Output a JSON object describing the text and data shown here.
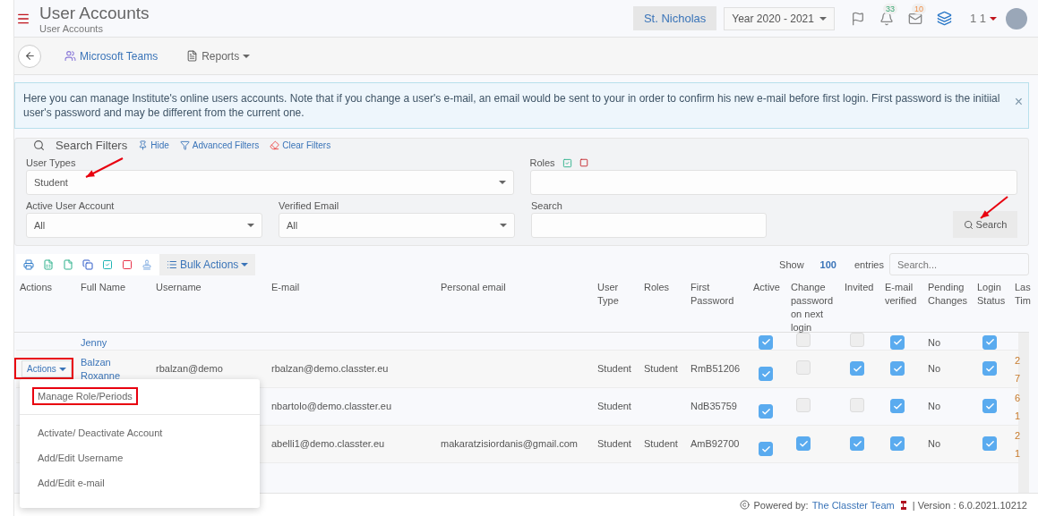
{
  "header": {
    "title": "User Accounts",
    "subtitle": "User Accounts",
    "school": "St. Nicholas",
    "year": "Year 2020 - 2021",
    "notifications": "33",
    "messages": "10",
    "user": "1 1"
  },
  "toolbar": {
    "links": [
      {
        "kind": "teams",
        "label": "Microsoft Teams"
      },
      {
        "kind": "reports",
        "label": "Reports"
      }
    ]
  },
  "alert": {
    "text": "Here you can manage Institute's online users accounts. Note that if you change a user's e-mail, an email would be sent to your in order to confirm his new e-mail before first login. First password is the initiial user's password and may be different from the current one.",
    "close": "×"
  },
  "filters": {
    "legend": "Search Filters",
    "links": [
      {
        "kind": "hide",
        "label": "Hide"
      },
      {
        "kind": "advanced",
        "label": "Advanced Filters"
      },
      {
        "kind": "clear",
        "label": "Clear Filters"
      }
    ],
    "user_types": {
      "label": "User Types",
      "value": "Student"
    },
    "roles": {
      "label": "Roles"
    },
    "active_account": {
      "label": "Active User Account",
      "value": "All"
    },
    "verified_email": {
      "label": "Verified Email",
      "value": "All"
    },
    "search": {
      "label": "Search"
    },
    "search_button": "Search"
  },
  "table_tools": {
    "bulk_actions": "Bulk Actions",
    "show": "Show",
    "page_size": "100",
    "entries": "entries",
    "search_placeholder": "Search..."
  },
  "table": {
    "columns": [
      "Actions",
      "Full Name",
      "Username",
      "E-mail",
      "Personal email",
      "User Type",
      "Roles",
      "First Password",
      "Active",
      "Change password on next login",
      "Invited",
      "E-mail verified",
      "Pending Changes",
      "Login Status",
      "Las Tim"
    ],
    "rows": [
      {
        "kind": "partial",
        "full_name": "Jenny",
        "active": true,
        "change_password": false,
        "invited": false,
        "email_verified": true,
        "pending": "No",
        "login_status": true
      },
      {
        "kind": "full",
        "action": "Actions",
        "full_name": "Balzan Roxanne",
        "username": "rbalzan@demo",
        "email": "rbalzan@demo.classter.eu",
        "user_type": "Student",
        "roles": "Student",
        "first_password": "RmB51206",
        "active": true,
        "change_password": false,
        "invited": true,
        "email_verified": true,
        "pending": "No",
        "login_status": true,
        "last": "2 7"
      },
      {
        "kind": "covered",
        "email": "nbartolo@demo.classter.eu",
        "user_type": "Student",
        "first_password": "NdB35759",
        "active": true,
        "change_password": false,
        "invited": false,
        "email_verified": true,
        "pending": "No",
        "login_status": true,
        "last": "6 1"
      },
      {
        "kind": "covered",
        "email": "abelli1@demo.classter.eu",
        "personal_email": "makaratzisiordanis@gmail.com",
        "user_type": "Student",
        "roles": "Student",
        "first_password": "AmB92700",
        "active": true,
        "change_password": true,
        "invited": true,
        "email_verified": true,
        "pending": "No",
        "login_status": true,
        "last": "2 1"
      }
    ]
  },
  "action_menu": {
    "items": [
      {
        "label": "Manage Role/Periods",
        "selected": true
      },
      {
        "label": "Activate/ Deactivate Account",
        "selected": false
      },
      {
        "label": "Add/Edit Username",
        "selected": false
      },
      {
        "label": "Add/Edit e-mail",
        "selected": false
      }
    ]
  },
  "footer": {
    "powered": "Powered by:",
    "team": "The Classter Team",
    "version": "| Version : 6.0.2021.10212"
  }
}
